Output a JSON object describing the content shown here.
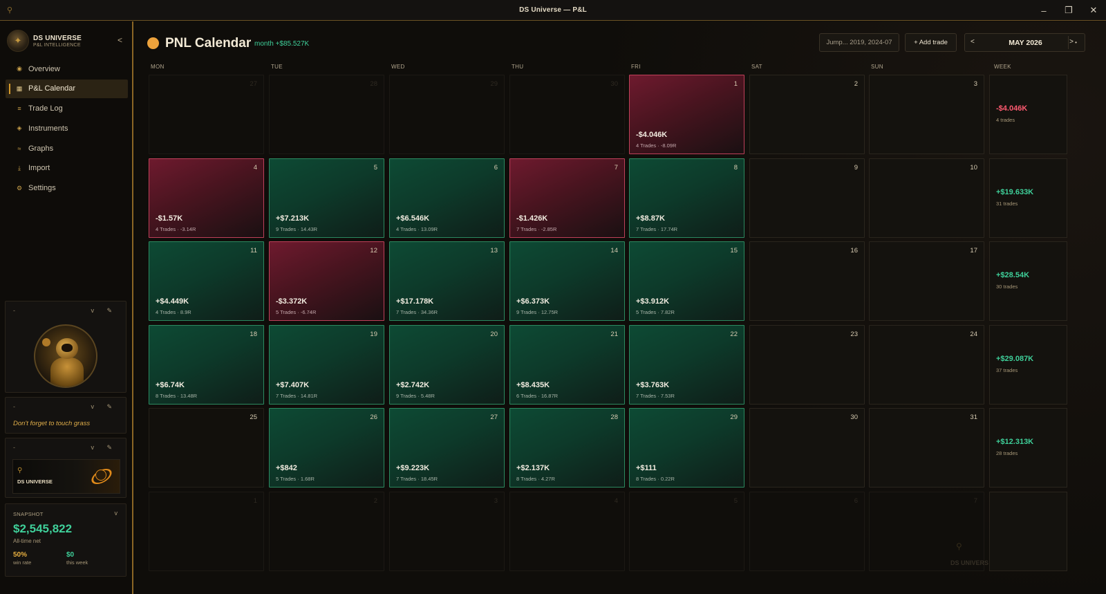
{
  "window": {
    "title": "DS Universe — P&L",
    "minimize": "–",
    "maximize": "❐",
    "close": "✕"
  },
  "brand": {
    "name": "DS UNIVERSE",
    "subtitle": "P&L INTELLIGENCE",
    "collapse": "<"
  },
  "nav": [
    {
      "label": "Overview",
      "icon": "◉",
      "active": false
    },
    {
      "label": "P&L Calendar",
      "icon": "▦",
      "active": true
    },
    {
      "label": "Trade Log",
      "icon": "≡",
      "active": false
    },
    {
      "label": "Instruments",
      "icon": "◈",
      "active": false
    },
    {
      "label": "Graphs",
      "icon": "≈",
      "active": false
    },
    {
      "label": "Import",
      "icon": "⤓",
      "active": false
    },
    {
      "label": "Settings",
      "icon": "⚙",
      "active": false
    }
  ],
  "widgets": {
    "dash": "-",
    "controls": "v ✎",
    "reminder": "Don't forget to touch grass",
    "banner_text": "DS UNIVERSE"
  },
  "snapshot": {
    "heading": "SNAPSHOT",
    "chevron": "v",
    "value": "$2,545,822",
    "value_label": "All-time net",
    "win_rate": "50%",
    "win_rate_label": "win rate",
    "this_week": "$0",
    "this_week_label": "this week"
  },
  "header": {
    "title": "PNL Calendar",
    "month_summary": "month +$85.527K",
    "jump_placeholder": "Jump... 2019, 2024-07",
    "add_trade": "+ Add trade",
    "prev": "<",
    "month": "MAY 2026",
    "next": ">",
    "more": "•"
  },
  "colors": {
    "win": "#3fd09a",
    "loss": "#ff5a70",
    "accent": "#eca23c"
  },
  "day_headers": [
    "MON",
    "TUE",
    "WED",
    "THU",
    "FRI",
    "SAT",
    "SUN",
    "WEEK"
  ],
  "weeks": [
    {
      "days": [
        {
          "day": "27",
          "kind": "dim"
        },
        {
          "day": "28",
          "kind": "dim"
        },
        {
          "day": "29",
          "kind": "dim"
        },
        {
          "day": "30",
          "kind": "dim"
        },
        {
          "day": "1",
          "kind": "loss",
          "pnl": "-$4.046K",
          "trades": "4 Trades · -8.09R"
        },
        {
          "day": "2",
          "kind": "weekend"
        },
        {
          "day": "3",
          "kind": "weekend"
        }
      ],
      "week": {
        "pnl": "-$4.046K",
        "trades": "4 trades",
        "kind": "loss"
      }
    },
    {
      "days": [
        {
          "day": "4",
          "kind": "loss",
          "pnl": "-$1.57K",
          "trades": "4 Trades · -3.14R"
        },
        {
          "day": "5",
          "kind": "win",
          "pnl": "+$7.213K",
          "trades": "9 Trades · 14.43R"
        },
        {
          "day": "6",
          "kind": "win",
          "pnl": "+$6.546K",
          "trades": "4 Trades · 13.09R"
        },
        {
          "day": "7",
          "kind": "loss",
          "pnl": "-$1.426K",
          "trades": "7 Trades · -2.85R"
        },
        {
          "day": "8",
          "kind": "win",
          "pnl": "+$8.87K",
          "trades": "7 Trades · 17.74R"
        },
        {
          "day": "9",
          "kind": "weekend"
        },
        {
          "day": "10",
          "kind": "weekend"
        }
      ],
      "week": {
        "pnl": "+$19.633K",
        "trades": "31 trades",
        "kind": "win"
      }
    },
    {
      "days": [
        {
          "day": "11",
          "kind": "win",
          "pnl": "+$4.449K",
          "trades": "4 Trades · 8.9R"
        },
        {
          "day": "12",
          "kind": "loss",
          "pnl": "-$3.372K",
          "trades": "5 Trades · -6.74R"
        },
        {
          "day": "13",
          "kind": "win",
          "pnl": "+$17.178K",
          "trades": "7 Trades · 34.36R"
        },
        {
          "day": "14",
          "kind": "win",
          "pnl": "+$6.373K",
          "trades": "9 Trades · 12.75R"
        },
        {
          "day": "15",
          "kind": "win",
          "pnl": "+$3.912K",
          "trades": "5 Trades · 7.82R"
        },
        {
          "day": "16",
          "kind": "weekend"
        },
        {
          "day": "17",
          "kind": "weekend"
        }
      ],
      "week": {
        "pnl": "+$28.54K",
        "trades": "30 trades",
        "kind": "win"
      }
    },
    {
      "days": [
        {
          "day": "18",
          "kind": "win",
          "pnl": "+$6.74K",
          "trades": "8 Trades · 13.48R"
        },
        {
          "day": "19",
          "kind": "win",
          "pnl": "+$7.407K",
          "trades": "7 Trades · 14.81R"
        },
        {
          "day": "20",
          "kind": "win",
          "pnl": "+$2.742K",
          "trades": "9 Trades · 5.48R"
        },
        {
          "day": "21",
          "kind": "win",
          "pnl": "+$8.435K",
          "trades": "6 Trades · 16.87R"
        },
        {
          "day": "22",
          "kind": "win",
          "pnl": "+$3.763K",
          "trades": "7 Trades · 7.53R"
        },
        {
          "day": "23",
          "kind": "weekend"
        },
        {
          "day": "24",
          "kind": "weekend"
        }
      ],
      "week": {
        "pnl": "+$29.087K",
        "trades": "37 trades",
        "kind": "win"
      }
    },
    {
      "days": [
        {
          "day": "25",
          "kind": "plain"
        },
        {
          "day": "26",
          "kind": "win",
          "pnl": "+$842",
          "trades": "5 Trades · 1.68R"
        },
        {
          "day": "27",
          "kind": "win",
          "pnl": "+$9.223K",
          "trades": "7 Trades · 18.45R"
        },
        {
          "day": "28",
          "kind": "win",
          "pnl": "+$2.137K",
          "trades": "8 Trades · 4.27R"
        },
        {
          "day": "29",
          "kind": "win",
          "pnl": "+$111",
          "trades": "8 Trades · 0.22R"
        },
        {
          "day": "30",
          "kind": "weekend"
        },
        {
          "day": "31",
          "kind": "weekend"
        }
      ],
      "week": {
        "pnl": "+$12.313K",
        "trades": "28 trades",
        "kind": "win"
      }
    },
    {
      "days": [
        {
          "day": "1",
          "kind": "dim"
        },
        {
          "day": "2",
          "kind": "dim"
        },
        {
          "day": "3",
          "kind": "dim"
        },
        {
          "day": "4",
          "kind": "dim"
        },
        {
          "day": "5",
          "kind": "dim"
        },
        {
          "day": "6",
          "kind": "dim"
        },
        {
          "day": "7",
          "kind": "dim"
        }
      ],
      "week": {
        "pnl": "",
        "trades": "",
        "kind": "empty"
      }
    }
  ],
  "watermark": "DS UNIVERS"
}
